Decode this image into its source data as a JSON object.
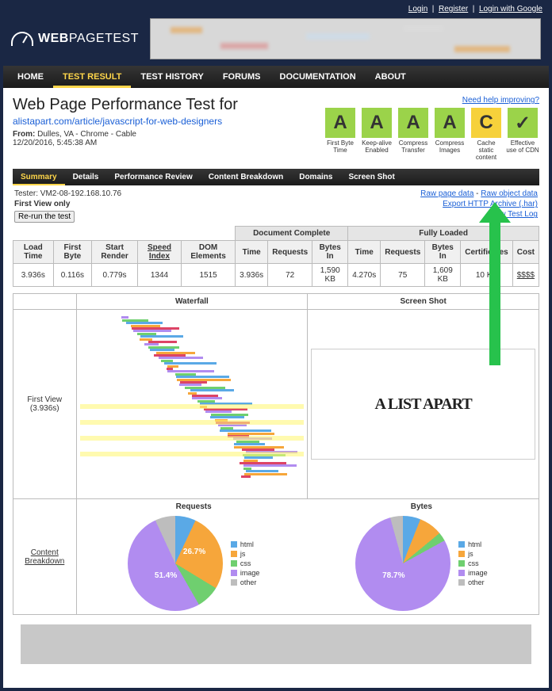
{
  "topbar": {
    "login": "Login",
    "register": "Register",
    "google": "Login with Google"
  },
  "logo": {
    "part1": "WEB",
    "part2": "PAGE",
    "part3": "TEST"
  },
  "nav": [
    "HOME",
    "TEST RESULT",
    "TEST HISTORY",
    "FORUMS",
    "DOCUMENTATION",
    "ABOUT"
  ],
  "title": "Web Page Performance Test for",
  "url": "alistapart.com/article/javascript-for-web-designers",
  "from_label": "From:",
  "from": "Dulles, VA - Chrome - Cable",
  "when": "12/20/2016, 5:45:38 AM",
  "help": "Need help improving?",
  "grades": [
    {
      "grade": "A",
      "cls": "g-A",
      "label": "First Byte Time"
    },
    {
      "grade": "A",
      "cls": "g-A",
      "label": "Keep-alive Enabled"
    },
    {
      "grade": "A",
      "cls": "g-A",
      "label": "Compress Transfer"
    },
    {
      "grade": "A",
      "cls": "g-A",
      "label": "Compress Images"
    },
    {
      "grade": "C",
      "cls": "g-C",
      "label": "Cache static content"
    },
    {
      "grade": "✓",
      "cls": "g-check",
      "label": "Effective use of CDN"
    }
  ],
  "subnav": [
    "Summary",
    "Details",
    "Performance Review",
    "Content Breakdown",
    "Domains",
    "Screen Shot"
  ],
  "tester_label": "Tester:",
  "tester": "VM2-08-192.168.10.76",
  "fvo": "First View only",
  "rerun": "Re-run the test",
  "links": {
    "raw_page": "Raw page data",
    "raw_obj": "Raw object data",
    "har": "Export HTTP Archive (.har)",
    "log": "View Test Log"
  },
  "table": {
    "grp1": "Document Complete",
    "grp2": "Fully Loaded",
    "h": [
      "Load Time",
      "First Byte",
      "Start Render",
      "Speed Index",
      "DOM Elements",
      "Time",
      "Requests",
      "Bytes In",
      "Time",
      "Requests",
      "Bytes In",
      "Certificates",
      "Cost"
    ],
    "r": [
      "3.936s",
      "0.116s",
      "0.779s",
      "1344",
      "1515",
      "3.936s",
      "72",
      "1,590 KB",
      "4.270s",
      "75",
      "1,609 KB",
      "10 KB",
      "$$$$"
    ]
  },
  "wf": {
    "h1": "Waterfall",
    "h2": "Screen Shot",
    "row_label": "First View",
    "row_time": "(3.936s)",
    "cb": "Content Breakdown",
    "ss_text": "A LIST APART"
  },
  "legend": [
    "html",
    "js",
    "css",
    "image",
    "other"
  ],
  "colors": {
    "html": "#5aa9e6",
    "js": "#f6a63b",
    "css": "#6fcf6f",
    "image": "#b18cf0",
    "other": "#bdbdbd"
  },
  "chart_data": [
    {
      "type": "pie",
      "title": "Requests",
      "series": [
        {
          "name": "html",
          "value": 7,
          "color": "#5aa9e6"
        },
        {
          "name": "js",
          "value": 26.7,
          "color": "#f6a63b"
        },
        {
          "name": "css",
          "value": 8,
          "color": "#6fcf6f"
        },
        {
          "name": "image",
          "value": 51.4,
          "color": "#b18cf0"
        },
        {
          "name": "other",
          "value": 6.9,
          "color": "#bdbdbd"
        }
      ],
      "labels_shown": {
        "image": "51.4%",
        "js": "26.7%"
      }
    },
    {
      "type": "pie",
      "title": "Bytes",
      "series": [
        {
          "name": "html",
          "value": 6,
          "color": "#5aa9e6"
        },
        {
          "name": "js",
          "value": 8,
          "color": "#f6a63b"
        },
        {
          "name": "css",
          "value": 3,
          "color": "#6fcf6f"
        },
        {
          "name": "image",
          "value": 78.7,
          "color": "#b18cf0"
        },
        {
          "name": "other",
          "value": 4.3,
          "color": "#bdbdbd"
        }
      ],
      "labels_shown": {
        "image": "78.7%"
      }
    }
  ]
}
